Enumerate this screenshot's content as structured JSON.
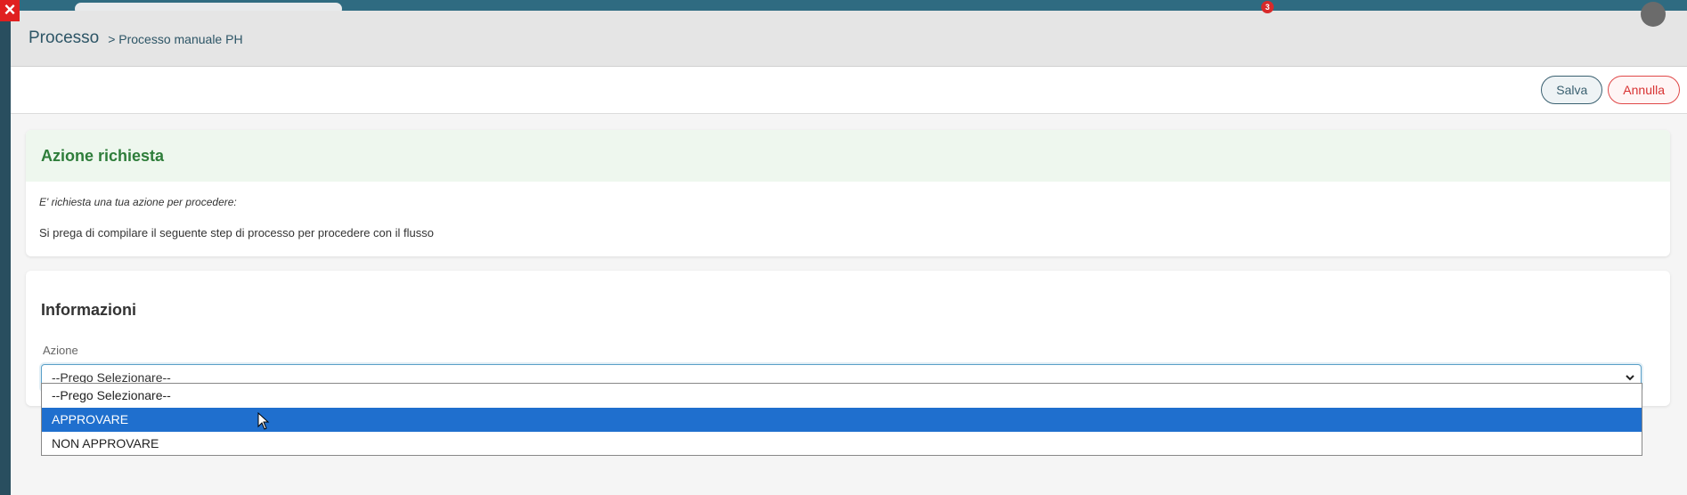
{
  "background": {
    "notification_count": "3"
  },
  "modal": {
    "title": "Processo",
    "breadcrumb": "> Processo manuale PH",
    "toolbar": {
      "save_label": "Salva",
      "cancel_label": "Annulla"
    },
    "action_card": {
      "title": "Azione richiesta",
      "italic_text": "E' richiesta una tua azione per procedere:",
      "text": "Si prega di compilare il seguente step di processo per procedere con il flusso"
    },
    "info_card": {
      "title": "Informazioni",
      "field_label": "Azione",
      "selected_value": "--Prego Selezionare--",
      "options": [
        "--Prego Selezionare--",
        "APPROVARE",
        "NON APPROVARE"
      ],
      "highlighted_option": "APPROVARE"
    }
  },
  "colors": {
    "accent_green": "#2e7d3a",
    "primary_blue": "#1f6fce",
    "cancel_red": "#d83232"
  }
}
